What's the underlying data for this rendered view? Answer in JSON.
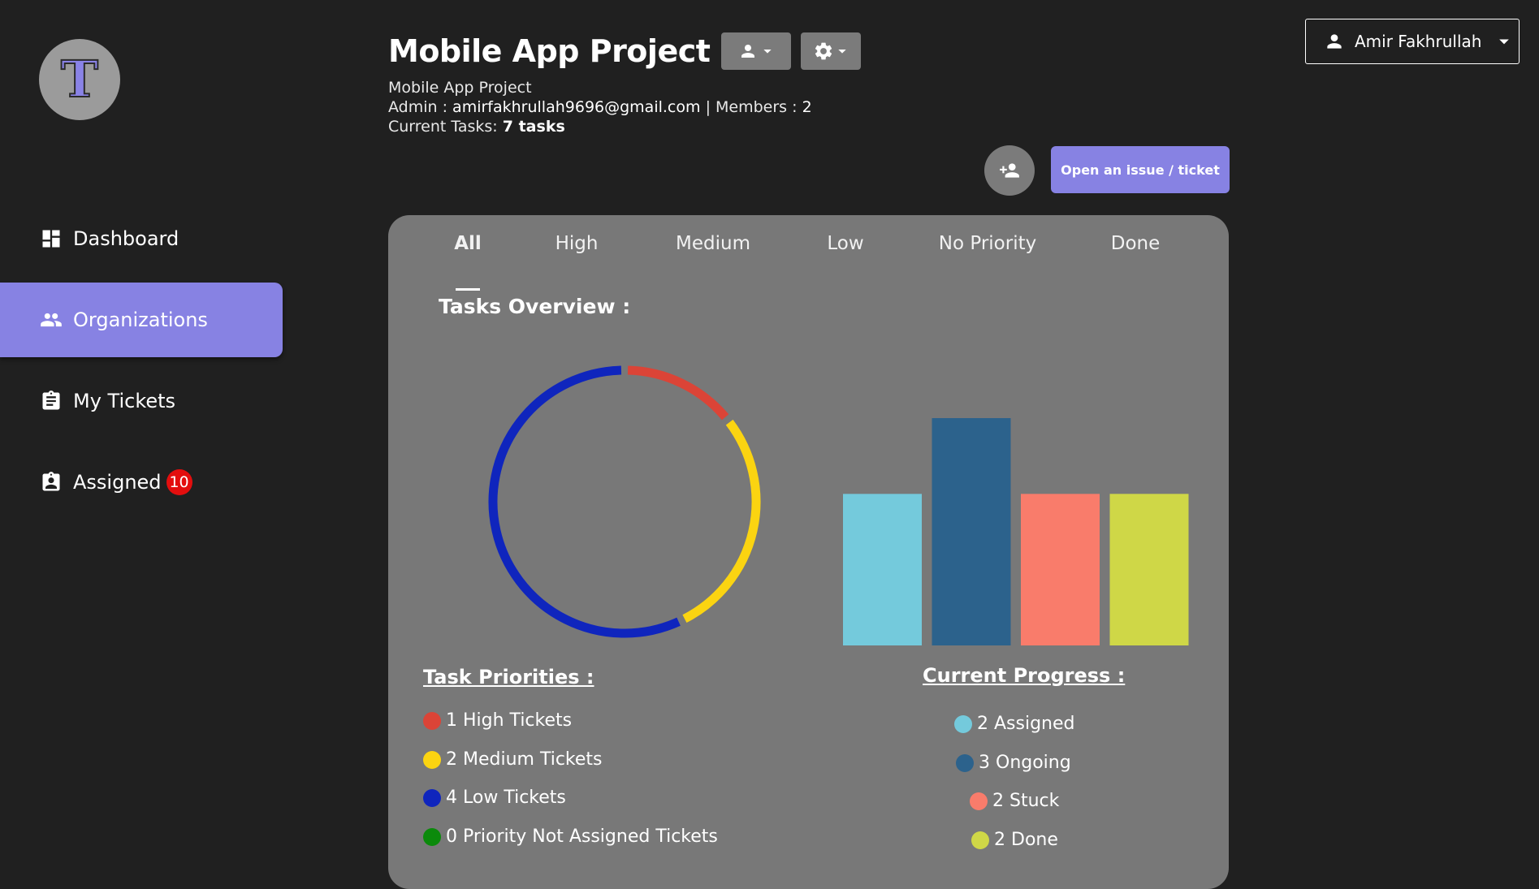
{
  "logo": {
    "letter": "T"
  },
  "sidebar": {
    "items": [
      {
        "label": "Dashboard",
        "icon": "dashboard-icon"
      },
      {
        "label": "Organizations",
        "icon": "people-icon",
        "active": true
      },
      {
        "label": "My Tickets",
        "icon": "clipboard-icon"
      },
      {
        "label": "Assigned",
        "icon": "assigned-icon",
        "badge": "10"
      }
    ]
  },
  "header": {
    "title": "Mobile App Project",
    "subtitle": "Mobile App Project",
    "admin_label": "Admin :",
    "admin_email": "amirfakhrullah9696@gmail.com",
    "separator": "|",
    "members_label": "Members :",
    "members_count": "2",
    "tasks_label": "Current Tasks:",
    "tasks_value": "7 tasks"
  },
  "account": {
    "name": "Amir Fakhrullah"
  },
  "actions": {
    "open_issue_label": "Open an issue / ticket"
  },
  "tabs": [
    "All",
    "High",
    "Medium",
    "Low",
    "No Priority",
    "Done"
  ],
  "overview": {
    "title": "Tasks Overview :"
  },
  "priorities": {
    "title": "Task Priorities :",
    "items": [
      {
        "count": "1",
        "label": "High Tickets",
        "color": "#db4437"
      },
      {
        "count": "2",
        "label": "Medium Tickets",
        "color": "#fbd411"
      },
      {
        "count": "4",
        "label": "Low Tickets",
        "color": "#0f25bd"
      },
      {
        "count": "0",
        "label": "Priority Not Assigned Tickets",
        "color": "#0b8a0b"
      }
    ]
  },
  "progress": {
    "title": "Current Progress :",
    "items": [
      {
        "count": "2",
        "label": "Assigned",
        "color": "#74cadc"
      },
      {
        "count": "3",
        "label": "Ongoing",
        "color": "#2c628c"
      },
      {
        "count": "2",
        "label": "Stuck",
        "color": "#f97c6b"
      },
      {
        "count": "2",
        "label": "Done",
        "color": "#cfd747"
      }
    ]
  },
  "chart_data": [
    {
      "type": "pie",
      "categories": [
        "High",
        "Medium",
        "Low",
        "No Priority"
      ],
      "values": [
        1,
        2,
        4,
        0
      ],
      "colors": [
        "#db4437",
        "#fbd411",
        "#0f25bd",
        "#0b8a0b"
      ],
      "title": "",
      "donut": true
    },
    {
      "type": "bar",
      "categories": [
        "Assigned",
        "Ongoing",
        "Stuck",
        "Done"
      ],
      "values": [
        2,
        3,
        2,
        2
      ],
      "colors": [
        "#74cadc",
        "#2c628c",
        "#f97c6b",
        "#cfd747"
      ],
      "title": "",
      "xlabel": "",
      "ylabel": "",
      "ylim": [
        0,
        3
      ],
      "grid": false
    }
  ]
}
